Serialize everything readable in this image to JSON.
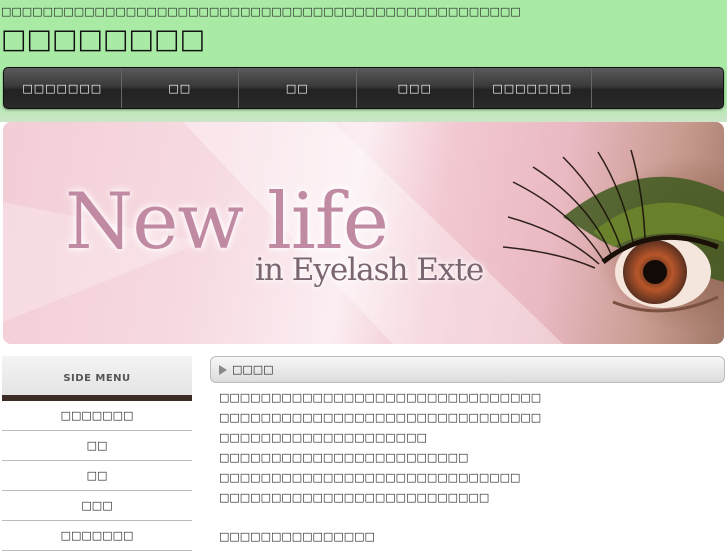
{
  "header": {
    "tagline": "□□□□□□□□□□□□□□□□□□□□□□□□□□□□□□□□□□□□□□□□□□□□□□□□□□",
    "site_title": "□□□□□□□□"
  },
  "globalnav": {
    "items": [
      {
        "label": "□□□□□□□"
      },
      {
        "label": "□□"
      },
      {
        "label": "□□"
      },
      {
        "label": "□□□"
      },
      {
        "label": "□□□□□□□"
      },
      {
        "label": ""
      }
    ]
  },
  "hero": {
    "line1": "New life",
    "line2": "in Eyelash Exte"
  },
  "sidebar": {
    "heading": "SIDE MENU",
    "items": [
      {
        "label": "□□□□□□□"
      },
      {
        "label": "□□"
      },
      {
        "label": "□□"
      },
      {
        "label": "□□□"
      },
      {
        "label": "□□□□□□□"
      }
    ]
  },
  "content": {
    "heading": "□□□□",
    "lines": [
      "□□□□□□□□□□□□□□□□□□□□□□□□□□□□□□□",
      "□□□□□□□□□□□□□□□□□□□□□□□□□□□□□□□",
      "□□□□□□□□□□□□□□□□□□□□",
      "□□□□□□□□□□□□□□□□□□□□□□□□",
      "□□□□□□□□□□□□□□□□□□□□□□□□□□□□□",
      "□□□□□□□□□□□□□□□□□□□□□□□□□□"
    ],
    "footer_line": "□□□□□□□□□□□□□□□"
  },
  "colors": {
    "header_bg": "#a9eba5",
    "nav_bg": "#2a2a2a",
    "hero_title": "#c08aa2",
    "side_rule": "#3a2c25"
  }
}
